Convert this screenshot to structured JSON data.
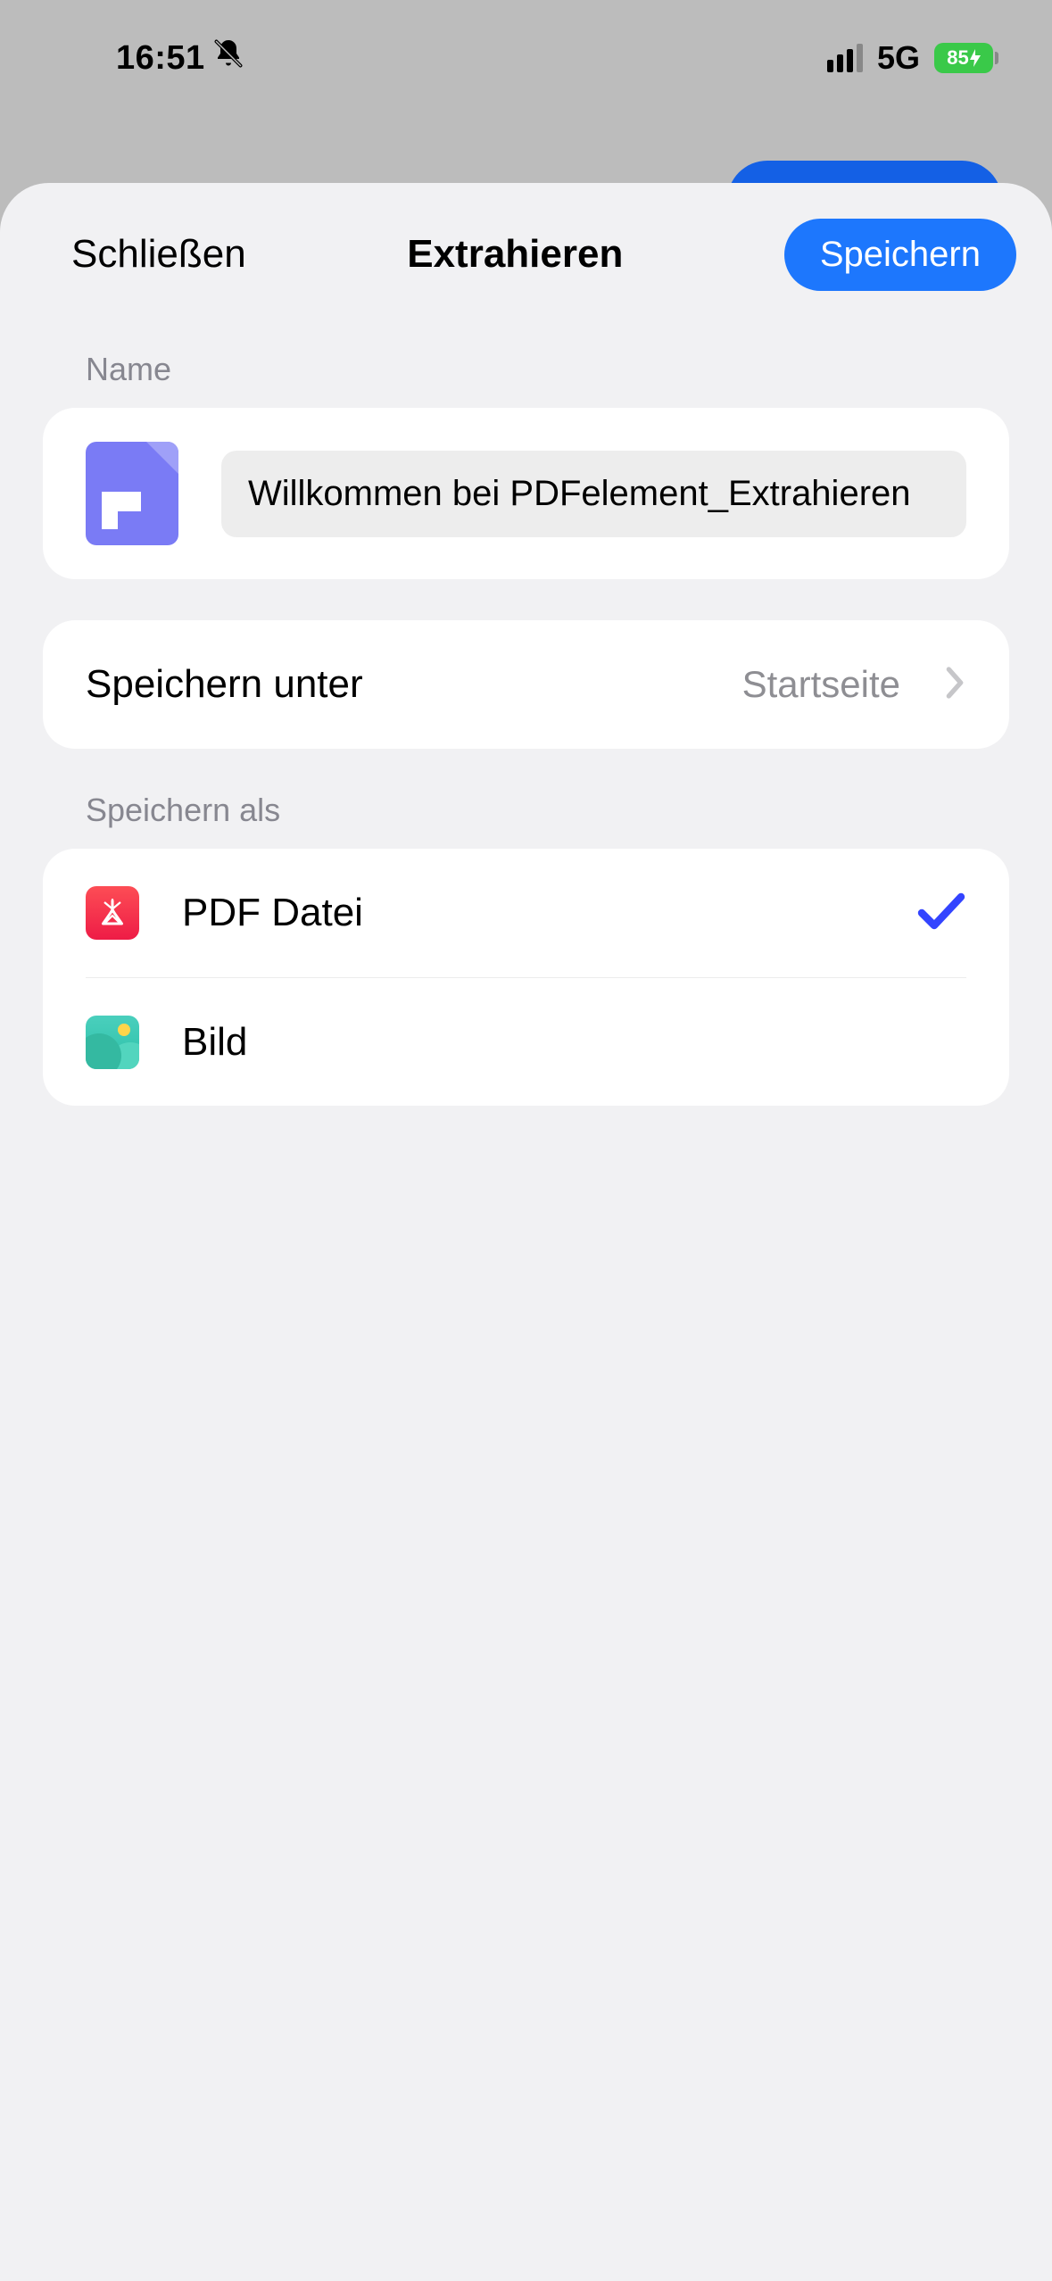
{
  "statusbar": {
    "time": "16:51",
    "network_type": "5G",
    "battery_percent": "85"
  },
  "navbar": {
    "close_label": "Schließen",
    "title": "Extrahieren",
    "save_label": "Speichern"
  },
  "sections": {
    "name_label": "Name",
    "file_name_value": "Willkommen bei PDFelement_Extrahieren",
    "save_under_label": "Speichern unter",
    "save_under_value": "Startseite",
    "save_as_label": "Speichern als",
    "format_options": {
      "pdf_label": "PDF Datei",
      "image_label": "Bild"
    },
    "selected_format": "pdf"
  }
}
